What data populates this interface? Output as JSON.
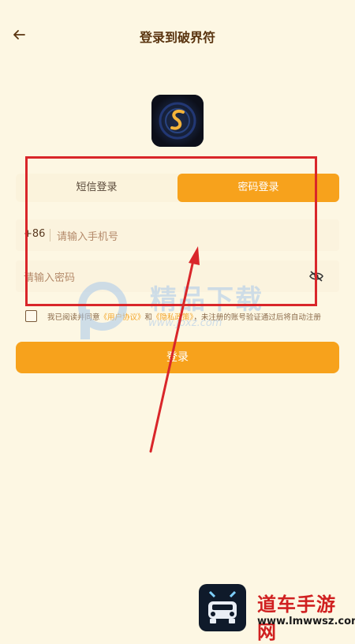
{
  "header": {
    "title": "登录到破界符",
    "back_icon": "arrow-left-icon"
  },
  "app_logo": {
    "icon": "app-logo-icon",
    "color": "#f3b33a"
  },
  "tabs": [
    {
      "label": "短信登录",
      "active": false
    },
    {
      "label": "密码登录",
      "active": true
    }
  ],
  "phone_field": {
    "country_code": "+86",
    "placeholder": "请输入手机号"
  },
  "password_field": {
    "placeholder": "请输入密码",
    "toggle_icon": "eye-hidden-icon"
  },
  "agreement": {
    "prefix": "我已阅读并同意",
    "user_agreement": "《用户协议》",
    "and": "和",
    "privacy_policy": "《隐私政策》",
    "suffix": "，未注册的账号验证通过后将自动注册",
    "checked": false
  },
  "login_button": {
    "label": "登录"
  },
  "watermark_center": {
    "text": "精品下载",
    "url": "www.jpxz.com"
  },
  "watermark_bottom": {
    "text": "道车手游网",
    "url": "www.lmwwsz.com"
  },
  "colors": {
    "accent": "#f7a21c",
    "background": "#fdf7e3",
    "annotation": "#d9262a"
  }
}
